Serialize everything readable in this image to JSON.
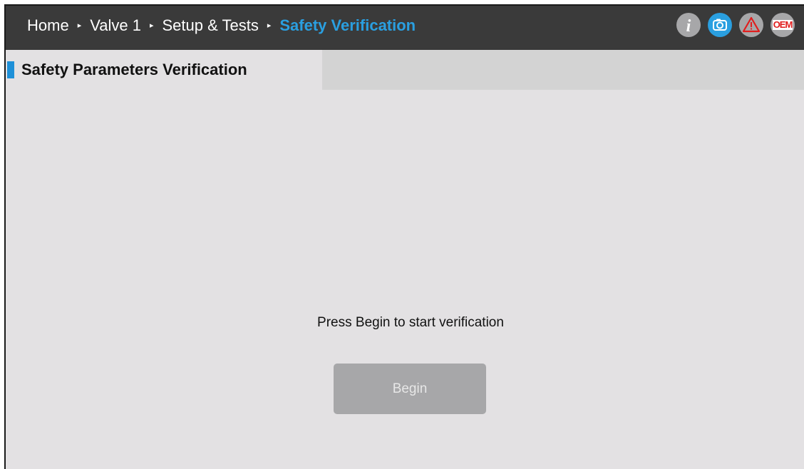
{
  "breadcrumb": {
    "items": [
      "Home",
      "Valve 1",
      "Setup & Tests"
    ],
    "current": "Safety Verification",
    "separator": "▸"
  },
  "toolbar": {
    "icons": [
      "info-icon",
      "camera-icon",
      "alarm-icon",
      "oem-icon"
    ],
    "info_glyph": "i",
    "oem_label": "OEM"
  },
  "tab": {
    "title": "Safety Parameters Verification"
  },
  "main": {
    "prompt": "Press Begin to start verification",
    "begin_label": "Begin",
    "begin_enabled": false
  },
  "colors": {
    "accent": "#2a9fe0",
    "topbar": "#3a3a3a",
    "panel": "#e3e1e3",
    "button_disabled": "#a7a7a9",
    "alarm": "#e11d1d"
  }
}
